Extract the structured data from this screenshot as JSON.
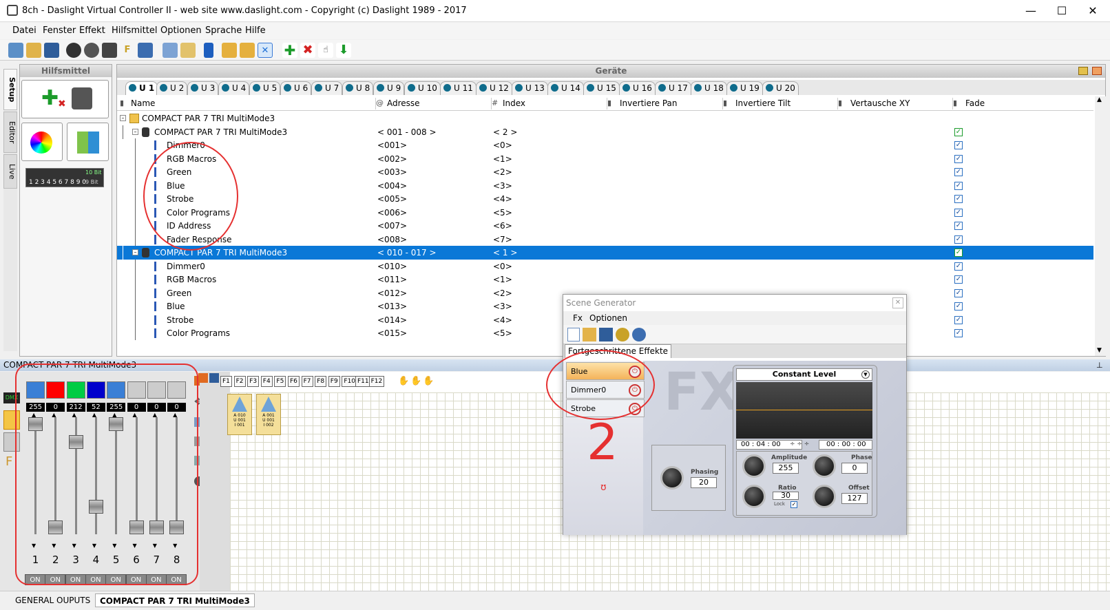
{
  "window": {
    "title": "8ch - Daslight Virtual Controller II  -  web site www.daslight.com  -  Copyright (c) Daslight 1989 - 2017",
    "minimize": "—",
    "maximize": "☐",
    "close": "✕"
  },
  "menu": [
    "Datei",
    "Fenster",
    "Effekt",
    "Hilfsmittel",
    "Optionen",
    "Sprache",
    "Hilfe"
  ],
  "sidetabs": [
    "Setup",
    "Editor",
    "Live"
  ],
  "hilfsmittel": {
    "title": "Hilfsmittel",
    "dmx_display": "1 2 3 4 5 6 7 8 9 0",
    "bit_labels": [
      "10 Bit",
      "9 Bit"
    ]
  },
  "geraete": {
    "title": "Geräte",
    "universe_tabs": [
      "U 1",
      "U 2",
      "U 3",
      "U 4",
      "U 5",
      "U 6",
      "U 7",
      "U 8",
      "U 9",
      "U 10",
      "U 11",
      "U 12",
      "U 13",
      "U 14",
      "U 15",
      "U 16",
      "U 17",
      "U 18",
      "U 19",
      "U 20"
    ],
    "columns": [
      "Name",
      "Adresse",
      "Index",
      "Invertiere Pan",
      "Invertiere Tilt",
      "Vertausche XY",
      "Fade"
    ],
    "column_icons": [
      "list-icon",
      "@",
      "#",
      "pan-icon",
      "tilt-icon",
      "swap-icon",
      "fade-icon"
    ],
    "rows": [
      {
        "name": "COMPACT PAR 7 TRI MultiMode3",
        "address": "",
        "index": "",
        "level": 0,
        "type": "folder",
        "fade": null,
        "selected": false
      },
      {
        "name": "COMPACT PAR 7 TRI MultiMode3",
        "address": "< 001 - 008 >",
        "index": "< 2 >",
        "level": 1,
        "type": "fixture",
        "fade": true,
        "selected": false
      },
      {
        "name": "Dimmer0",
        "address": "<001>",
        "index": "<0>",
        "level": 2,
        "type": "channel",
        "fade": true,
        "selected": false
      },
      {
        "name": "RGB Macros",
        "address": "<002>",
        "index": "<1>",
        "level": 2,
        "type": "channel",
        "fade": true,
        "selected": false
      },
      {
        "name": "Green",
        "address": "<003>",
        "index": "<2>",
        "level": 2,
        "type": "channel",
        "fade": true,
        "selected": false
      },
      {
        "name": "Blue",
        "address": "<004>",
        "index": "<3>",
        "level": 2,
        "type": "channel",
        "fade": true,
        "selected": false
      },
      {
        "name": "Strobe",
        "address": "<005>",
        "index": "<4>",
        "level": 2,
        "type": "channel",
        "fade": true,
        "selected": false
      },
      {
        "name": "Color Programs",
        "address": "<006>",
        "index": "<5>",
        "level": 2,
        "type": "channel",
        "fade": true,
        "selected": false
      },
      {
        "name": "ID Address",
        "address": "<007>",
        "index": "<6>",
        "level": 2,
        "type": "channel",
        "fade": true,
        "selected": false
      },
      {
        "name": "Fader Response",
        "address": "<008>",
        "index": "<7>",
        "level": 2,
        "type": "channel",
        "fade": true,
        "selected": false
      },
      {
        "name": "COMPACT PAR 7 TRI MultiMode3",
        "address": "< 010 - 017 >",
        "index": "< 1 >",
        "level": 1,
        "type": "fixture",
        "fade": true,
        "selected": true
      },
      {
        "name": "Dimmer0",
        "address": "<010>",
        "index": "<0>",
        "level": 2,
        "type": "channel",
        "fade": true,
        "selected": false
      },
      {
        "name": "RGB Macros",
        "address": "<011>",
        "index": "<1>",
        "level": 2,
        "type": "channel",
        "fade": true,
        "selected": false
      },
      {
        "name": "Green",
        "address": "<012>",
        "index": "<2>",
        "level": 2,
        "type": "channel",
        "fade": true,
        "selected": false
      },
      {
        "name": "Blue",
        "address": "<013>",
        "index": "<3>",
        "level": 2,
        "type": "channel",
        "fade": true,
        "selected": false
      },
      {
        "name": "Strobe",
        "address": "<014>",
        "index": "<4>",
        "level": 2,
        "type": "channel",
        "fade": true,
        "selected": false
      },
      {
        "name": "Color Programs",
        "address": "<015>",
        "index": "<5>",
        "level": 2,
        "type": "channel",
        "fade": true,
        "selected": false
      }
    ]
  },
  "lower_panel": {
    "title": "COMPACT PAR 7 TRI MultiMode3",
    "dmx_label": "DMX",
    "channels": [
      {
        "num": "1",
        "value": "255",
        "swatch": "#3a7fd6",
        "level": 1.0
      },
      {
        "num": "2",
        "value": "0",
        "swatch": "#ff0000",
        "level": 0.0
      },
      {
        "num": "3",
        "value": "212",
        "swatch": "#00cc44",
        "level": 0.83
      },
      {
        "num": "4",
        "value": "52",
        "swatch": "#0000cc",
        "level": 0.2
      },
      {
        "num": "5",
        "value": "255",
        "swatch": "#3a7fd6",
        "level": 1.0
      },
      {
        "num": "6",
        "value": "0",
        "swatch": "#cccccc",
        "level": 0.0
      },
      {
        "num": "7",
        "value": "0",
        "swatch": "#cccccc",
        "level": 0.0
      },
      {
        "num": "8",
        "value": "0",
        "swatch": "#cccccc",
        "level": 0.0
      }
    ],
    "on_label": "ON",
    "fkeys": [
      "F1",
      "F2",
      "F3",
      "F4",
      "F5",
      "F6",
      "F7",
      "F8",
      "F9",
      "F10",
      "F11",
      "F12"
    ],
    "scene_tiles": [
      {
        "lines": [
          "A 010",
          "U 001",
          "I 001"
        ]
      },
      {
        "lines": [
          "A 001",
          "U 001",
          "I 002"
        ]
      }
    ]
  },
  "bottom_tabs": [
    "GENERAL OUPUTS",
    "COMPACT PAR 7 TRI MultiMode3"
  ],
  "scene_generator": {
    "title": "Scene Generator",
    "menu": [
      "Fx",
      "Optionen"
    ],
    "tab": "Fortgeschrittene Effekte",
    "effects": [
      {
        "name": "Blue",
        "active": true
      },
      {
        "name": "Dimmer0",
        "active": false
      },
      {
        "name": "Strobe",
        "active": false
      }
    ],
    "watermark": "FX",
    "curve_label": "Constant Level",
    "time_start": "00 : 04 : 00",
    "time_end": "00 : 00 : 00",
    "phasing_label": "Phasing",
    "phasing_value": "20",
    "amplitude_label": "Amplitude",
    "amplitude_value": "255",
    "phase_label": "Phase",
    "phase_value": "0",
    "ratio_label": "Ratio",
    "ratio_value": "30",
    "lock_label": "Lock",
    "offset_label": "Offset",
    "offset_value": "127",
    "handwriting": "2"
  }
}
